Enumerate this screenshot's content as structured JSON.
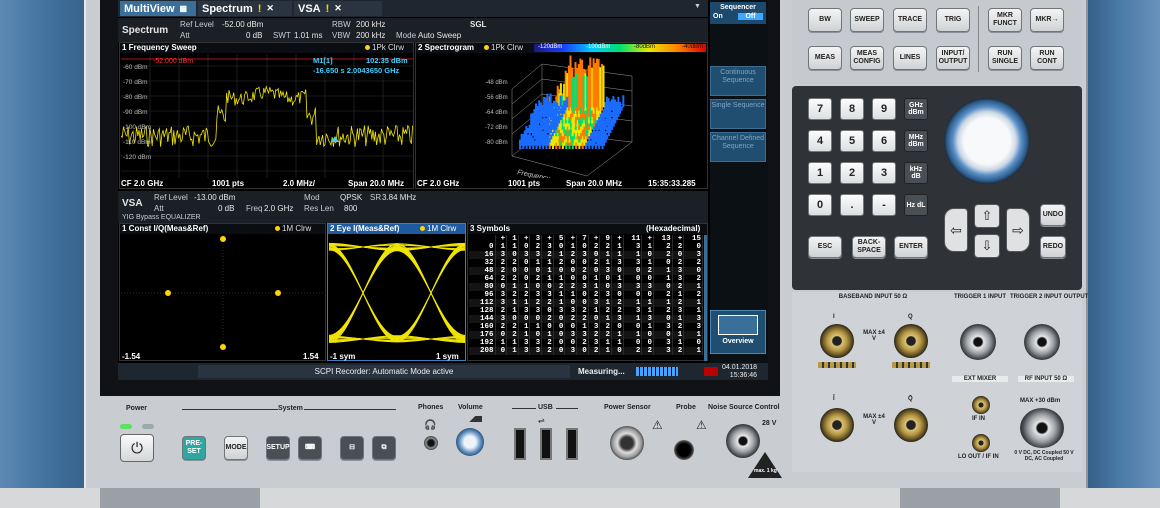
{
  "tabs": {
    "multiview": "MultiView",
    "spectrum": "Spectrum",
    "vsa": "VSA",
    "warn_symbol": "!",
    "close_symbol": "✕"
  },
  "spectrum_header": {
    "name": "Spectrum",
    "ref_level_label": "Ref Level",
    "ref_level": "-52.00 dBm",
    "att_label": "Att",
    "att": "0 dB",
    "swt_label": "SWT",
    "swt": "1.01 ms",
    "rbw_label": "RBW",
    "rbw": "200 kHz",
    "vbw_label": "VBW",
    "vbw": "200 kHz",
    "mode_label": "Mode",
    "mode": "Auto Sweep",
    "sgl": "SGL"
  },
  "freq_sweep": {
    "title": "1 Frequency Sweep",
    "trace": "1Pk Clrw",
    "ref_line": "-52.000 dBm",
    "marker_label": "M1[1]",
    "marker_level": "102.35 dBm",
    "marker_pos": "-16.650 s 2.0043650 GHz",
    "y_ticks": [
      "-60 dBm",
      "-70 dBm",
      "-80 dBm",
      "-90 dBm",
      "-100 dBm",
      "-110 dBm",
      "-120 dBm"
    ],
    "footer_cf": "CF 2.0 GHz",
    "footer_pts": "1001 pts",
    "footer_div": "2.0 MHz/",
    "footer_span": "Span 20.0 MHz"
  },
  "spectrogram": {
    "title": "2 Spectrogram",
    "trace": "1Pk Clrw",
    "colorbar_labels": [
      "-120dBm",
      "-100dBm",
      "-80dBm",
      "-40dBm"
    ],
    "z_ticks": [
      "-48 dBm",
      "-56 dBm",
      "-64 dBm",
      "-72 dBm",
      "-80 dBm"
    ],
    "axis_label": "Frequency",
    "footer_cf": "CF 2.0 GHz",
    "footer_pts": "1001 pts",
    "footer_span": "Span 20.0 MHz",
    "footer_time": "15:35:33.285"
  },
  "vsa_header": {
    "name": "VSA",
    "ref_level_label": "Ref Level",
    "ref_level": "-13.00 dBm",
    "att_label": "Att",
    "att": "0 dB",
    "freq_label": "Freq",
    "freq": "2.0 GHz",
    "mod_label": "Mod",
    "mod": "QPSK",
    "sr_label": "SR",
    "sr": "3.84 MHz",
    "res_len_label": "Res Len",
    "res_len": "800",
    "yig": "YIG Bypass EQUALIZER"
  },
  "const": {
    "title": "1 Const I/Q(Meas&Ref)",
    "trace": "1M Clrw",
    "x_min": "-1.54",
    "x_max": "1.54"
  },
  "eye": {
    "title": "2 Eye I(Meas&Ref)",
    "trace": "1M Clrw",
    "x_min": "-1 sym",
    "x_max": "1 sym"
  },
  "symbols": {
    "title": "3 Symbols",
    "format": "(Hexadecimal)",
    "col_headers": [
      "+",
      "1",
      "+",
      "3",
      "+",
      "5",
      "+",
      "7",
      "+",
      "9",
      "+",
      "11",
      "+",
      "13",
      "+",
      "15"
    ],
    "row_labels": [
      "0",
      "16",
      "32",
      "48",
      "64",
      "80",
      "96",
      "112",
      "128",
      "144",
      "160",
      "176",
      "192",
      "208"
    ],
    "rows": [
      [
        "1",
        "1",
        "0",
        "2",
        "3",
        "0",
        "1",
        "0",
        "2",
        "2",
        "1",
        "3",
        "1",
        "2",
        "2",
        "0"
      ],
      [
        "3",
        "0",
        "3",
        "3",
        "2",
        "1",
        "2",
        "3",
        "0",
        "1",
        "1",
        "1",
        "0",
        "2",
        "0",
        "3"
      ],
      [
        "2",
        "2",
        "0",
        "1",
        "1",
        "2",
        "0",
        "0",
        "2",
        "1",
        "3",
        "3",
        "1",
        "0",
        "2",
        "2"
      ],
      [
        "2",
        "0",
        "0",
        "0",
        "1",
        "0",
        "0",
        "2",
        "0",
        "3",
        "0",
        "0",
        "2",
        "1",
        "3",
        "0"
      ],
      [
        "2",
        "2",
        "0",
        "2",
        "1",
        "1",
        "0",
        "0",
        "1",
        "0",
        "1",
        "0",
        "0",
        "1",
        "3",
        "2"
      ],
      [
        "0",
        "1",
        "1",
        "0",
        "0",
        "2",
        "2",
        "3",
        "1",
        "0",
        "3",
        "3",
        "3",
        "0",
        "2",
        "1"
      ],
      [
        "3",
        "2",
        "2",
        "3",
        "3",
        "1",
        "1",
        "0",
        "2",
        "3",
        "0",
        "0",
        "0",
        "2",
        "1",
        "2"
      ],
      [
        "3",
        "1",
        "1",
        "2",
        "2",
        "1",
        "0",
        "0",
        "3",
        "1",
        "2",
        "1",
        "1",
        "1",
        "2",
        "1"
      ],
      [
        "2",
        "1",
        "3",
        "3",
        "0",
        "3",
        "3",
        "2",
        "1",
        "2",
        "2",
        "3",
        "1",
        "2",
        "3",
        "1"
      ],
      [
        "3",
        "0",
        "0",
        "0",
        "2",
        "0",
        "2",
        "2",
        "0",
        "1",
        "3",
        "1",
        "3",
        "0",
        "1",
        "3"
      ],
      [
        "2",
        "2",
        "1",
        "1",
        "0",
        "0",
        "0",
        "1",
        "3",
        "2",
        "0",
        "0",
        "1",
        "3",
        "2",
        "3"
      ],
      [
        "0",
        "2",
        "1",
        "0",
        "1",
        "0",
        "3",
        "3",
        "2",
        "2",
        "1",
        "1",
        "0",
        "0",
        "1",
        "1"
      ],
      [
        "1",
        "1",
        "3",
        "3",
        "2",
        "0",
        "0",
        "2",
        "3",
        "1",
        "1",
        "0",
        "0",
        "3",
        "1",
        "0"
      ],
      [
        "0",
        "1",
        "3",
        "3",
        "2",
        "0",
        "3",
        "0",
        "2",
        "1",
        "0",
        "2",
        "2",
        "3",
        "2",
        "1"
      ]
    ]
  },
  "sidebar": {
    "sequencer_title": "Sequencer",
    "on": "On",
    "off": "Off",
    "continuous": "Continuous Sequence",
    "single": "Single Sequence",
    "channel_defined": "Channel Defined Sequence",
    "overview": "Overview"
  },
  "statusbar": {
    "scpi": "SCPI Recorder: Automatic Mode active",
    "measuring": "Measuring...",
    "date": "04.01.2018",
    "time": "15:36:46"
  },
  "keys_top": [
    "BW",
    "SWEEP",
    "TRACE",
    "TRIG",
    "MKR FUNCT",
    "MKR→",
    "MEAS",
    "MEAS CONFIG",
    "LINES",
    "INPUT/ OUTPUT",
    "RUN SINGLE",
    "RUN CONT"
  ],
  "numpad": [
    "7",
    "8",
    "9",
    "4",
    "5",
    "6",
    "1",
    "2",
    "3",
    "0",
    ".",
    "-"
  ],
  "units": [
    "GHz dBm",
    "MHz dBm",
    "kHz dB",
    "Hz dL"
  ],
  "keys_bottom": {
    "esc": "ESC",
    "backspace": "BACK- SPACE",
    "enter": "ENTER",
    "undo": "UNDO",
    "redo": "REDO"
  },
  "connectors": {
    "baseband": "BASEBAND INPUT 50 Ω",
    "trig1": "TRIGGER 1 INPUT",
    "trig2": "TRIGGER 2 INPUT OUTPUT",
    "i1": "I",
    "q1": "Q",
    "i2": "Ī",
    "q2": "Q̄",
    "max1": "MAX ±4 V",
    "max2": "MAX ±4 V",
    "ext_mixer": "EXT MIXER",
    "if_in": "IF IN",
    "lo_out": "LO OUT / IF IN",
    "rf_input": "RF INPUT 50 Ω",
    "rf_max": "MAX +30 dBm",
    "rf_note": "0 V DC, DC Coupled 50 V DC, AC Coupled"
  },
  "bottom": {
    "power": "Power",
    "system": "System",
    "phones": "Phones",
    "volume": "Volume",
    "usb": "USB",
    "power_sensor": "Power Sensor",
    "probe": "Probe",
    "noise_source": "Noise Source Control",
    "v28": "28 V",
    "preset": "PRE- SET",
    "mode": "MODE",
    "setup": "SETUP",
    "max_label": "max. 1 kg"
  }
}
